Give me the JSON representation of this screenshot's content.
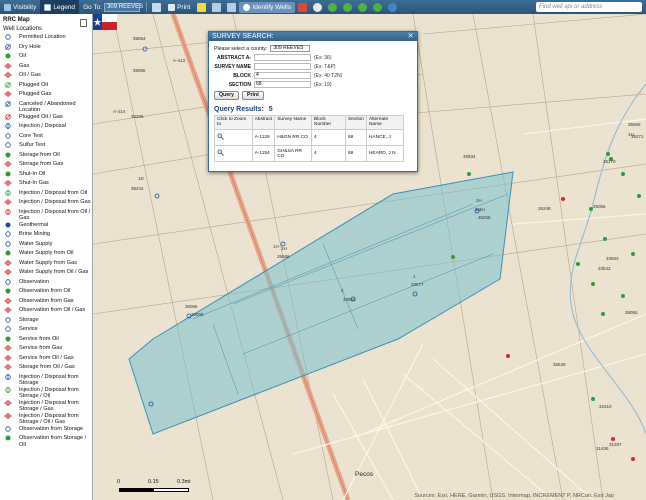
{
  "toolbar": {
    "visibility_label": "Visibility",
    "legend_label": "Legend",
    "goto_label": "Go To:",
    "goto_value": "309 REEVES",
    "print_label": "Print",
    "identify_label": "Identify Wells",
    "search_placeholder": "Find well api or address",
    "colors": {
      "bar": "#2c5478",
      "pressed": "#1e3f5e"
    }
  },
  "sidebar": {
    "title": "RRC Map",
    "subtitle": "Well Locations",
    "items": [
      {
        "label": "Permitted Location",
        "icon": "circle-outline",
        "color": "#1a4fa0"
      },
      {
        "label": "Dry Hole",
        "icon": "circle-cross",
        "color": "#1a4fa0"
      },
      {
        "label": "Oil",
        "icon": "circle-filled",
        "color": "#2e9b36"
      },
      {
        "label": "Gas",
        "icon": "star-burst",
        "color": "#d12b2b"
      },
      {
        "label": "Oil / Gas",
        "icon": "circle-star",
        "color": "#d12b2b"
      },
      {
        "label": "Plugged Oil",
        "icon": "circle-slash",
        "color": "#2e9b36"
      },
      {
        "label": "Plugged Gas",
        "icon": "star-slash",
        "color": "#d12b2b"
      },
      {
        "label": "Canceled / Abandoned Location",
        "icon": "circle-x",
        "color": "#1a4fa0"
      },
      {
        "label": "Plugged Oil / Gas",
        "icon": "circle-slash",
        "color": "#d12b2b"
      },
      {
        "label": "Injection / Disposal",
        "icon": "arrow-down",
        "color": "#1a4fa0"
      },
      {
        "label": "Core Test",
        "icon": "circle-dot",
        "color": "#1a4fa0"
      },
      {
        "label": "Sulfur Test",
        "icon": "circle-s",
        "color": "#1a4fa0"
      },
      {
        "label": "Storage from Oil",
        "icon": "circle-filled",
        "color": "#2e9b36"
      },
      {
        "label": "Storage from Gas",
        "icon": "star-burst",
        "color": "#d12b2b"
      },
      {
        "label": "Shut-In Oil",
        "icon": "circle-filled",
        "color": "#2e9b36"
      },
      {
        "label": "Shut-In Gas",
        "icon": "star-burst",
        "color": "#d12b2b"
      },
      {
        "label": "Injection / Disposal from Oil",
        "icon": "arrow-circle",
        "color": "#2e9b36"
      },
      {
        "label": "Injection / Disposal from Gas",
        "icon": "arrow-star",
        "color": "#d12b2b"
      },
      {
        "label": "Injection / Disposal from Oil / Gas",
        "icon": "arrow-circle",
        "color": "#d12b2b"
      },
      {
        "label": "Geothermal",
        "icon": "circle-filled",
        "color": "#1a4fa0"
      },
      {
        "label": "Brine Mining",
        "icon": "circle-dot",
        "color": "#1a4fa0"
      },
      {
        "label": "Water Supply",
        "icon": "circle-w",
        "color": "#1a4fa0"
      },
      {
        "label": "Water Supply from Oil",
        "icon": "circle-filled",
        "color": "#2e9b36"
      },
      {
        "label": "Water Supply from Gas",
        "icon": "star-burst",
        "color": "#d12b2b"
      },
      {
        "label": "Water Supply from Oil / Gas",
        "icon": "circle-star",
        "color": "#d12b2b"
      },
      {
        "label": "Observation",
        "icon": "circle-o",
        "color": "#1a4fa0"
      },
      {
        "label": "Observation from Oil",
        "icon": "circle-filled",
        "color": "#2e9b36"
      },
      {
        "label": "Observation from Gas",
        "icon": "star-burst",
        "color": "#d12b2b"
      },
      {
        "label": "Observation from Oil / Gas",
        "icon": "circle-star",
        "color": "#d12b2b"
      },
      {
        "label": "Storage",
        "icon": "circle-outline",
        "color": "#1a4fa0"
      },
      {
        "label": "Service",
        "icon": "circle-outline",
        "color": "#1a4fa0"
      },
      {
        "label": "Service from Oil",
        "icon": "circle-filled",
        "color": "#2e9b36"
      },
      {
        "label": "Service from Gas",
        "icon": "star-burst",
        "color": "#d12b2b"
      },
      {
        "label": "Service from Oil / Gas",
        "icon": "circle-star",
        "color": "#d12b2b"
      },
      {
        "label": "Storage from Oil / Gas",
        "icon": "circle-star",
        "color": "#d12b2b"
      },
      {
        "label": "Injection / Disposal from Storage",
        "icon": "arrow-circle",
        "color": "#1a4fa0"
      },
      {
        "label": "Injection / Disposal from Storage / Oil",
        "icon": "arrow-circle",
        "color": "#2e9b36"
      },
      {
        "label": "Injection / Disposal from Storage / Gas",
        "icon": "arrow-star",
        "color": "#d12b2b"
      },
      {
        "label": "Injection / Disposal from Storage / Oil / Gas",
        "icon": "arrow-star",
        "color": "#d12b2b"
      },
      {
        "label": "Observation from Storage",
        "icon": "circle-o",
        "color": "#1a4fa0"
      },
      {
        "label": "Observation from Storage / Oil",
        "icon": "circle-filled",
        "color": "#2e9b36"
      }
    ]
  },
  "dialog": {
    "title": "SURVEY SEARCH:",
    "county_prompt": "Please select a county:",
    "county_value": "309 REEVES",
    "fields": [
      {
        "label": "ABSTRACT A-",
        "value": "",
        "hint": "(Ex: 36)"
      },
      {
        "label": "SURVEY NAME",
        "value": "",
        "hint": "(Ex: T&P)"
      },
      {
        "label": "BLOCK",
        "value": "4",
        "hint": "(Ex: 40 T2N)"
      },
      {
        "label": "SECTION",
        "value": "68",
        "hint": "(Ex: 19)"
      }
    ],
    "query_button": "Query",
    "print_button": "Print",
    "results_label": "Query Results:",
    "results_count": "5",
    "columns": [
      "Click to Zoom to",
      "Abstract",
      "Survey Name",
      "Block Number",
      "Section",
      "Alternate Name"
    ],
    "rows": [
      {
        "abstract": "A-1126",
        "survey": "H&GN RR CO",
        "block": "4",
        "section": "68",
        "alt": "HANCE, J"
      },
      {
        "abstract": "A-1154",
        "survey": "GH&SA RR CO",
        "block": "4",
        "section": "68",
        "alt": "HEARD, J N"
      }
    ]
  },
  "map": {
    "labels": [
      {
        "text": "35064"
      },
      {
        "text": "35086"
      },
      {
        "text": "A-413"
      },
      {
        "text": "A-414"
      },
      {
        "text": "35205"
      },
      {
        "text": "1D"
      },
      {
        "text": "35244"
      },
      {
        "text": "1H"
      },
      {
        "text": "35934"
      },
      {
        "text": "1H"
      },
      {
        "text": "35686"
      },
      {
        "text": "1H"
      },
      {
        "text": "36665"
      },
      {
        "text": "1H"
      },
      {
        "text": "36066"
      },
      {
        "text": "2"
      },
      {
        "text": "33553"
      },
      {
        "text": "2H"
      },
      {
        "text": "1H"
      },
      {
        "text": "36255"
      },
      {
        "text": "1"
      },
      {
        "text": "33577"
      },
      {
        "text": "36006"
      },
      {
        "text": "35526"
      },
      {
        "text": "32410"
      },
      {
        "text": "31287"
      },
      {
        "text": "31436"
      },
      {
        "text": "35170"
      },
      {
        "text": "35056"
      },
      {
        "text": "33542"
      },
      {
        "text": "38055"
      },
      {
        "text": "33553"
      },
      {
        "text": "36248"
      },
      {
        "text": "36271"
      }
    ],
    "city": "Pecos",
    "scale_labels": [
      "0",
      "0.15",
      "0.3mi"
    ],
    "attribution": "Sources: Esri, HERE, Garmin, USGS, Intermap, INCREMENT P, NRCan, Esri Jap"
  }
}
